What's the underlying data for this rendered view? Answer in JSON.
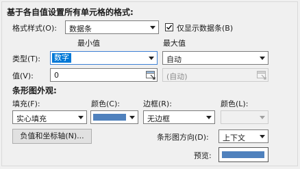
{
  "header": {
    "title": "基于各自值设置所有单元格的格式:"
  },
  "format_style": {
    "label": "格式样式(O):",
    "value": "数据条"
  },
  "show_bar_only": {
    "label": "仅显示数据条(B)",
    "checked": true
  },
  "min_max": {
    "min_label": "最小值",
    "max_label": "最大值"
  },
  "type": {
    "label": "类型(T):",
    "min_value": "数字",
    "max_value": "自动"
  },
  "value": {
    "label": "值(V):",
    "min_value": "0",
    "max_value": "(自动)"
  },
  "bar_appearance": {
    "title": "条形图外观:",
    "fill_label": "填充(F):",
    "fill_value": "实心填充",
    "fill_color_label": "颜色(C):",
    "border_label": "边框(R):",
    "border_value": "无边框",
    "border_color_label": "颜色(L):",
    "bar_color": "#4f81bd"
  },
  "negative_axis": {
    "label": "负值和坐标轴(N)..."
  },
  "bar_direction": {
    "label": "条形图方向(D):",
    "value": "上下文"
  },
  "preview": {
    "label": "预览:"
  },
  "icons": {
    "dropdown": "chevron-down-icon",
    "collapse": "range-select-icon",
    "check": "check-icon"
  }
}
